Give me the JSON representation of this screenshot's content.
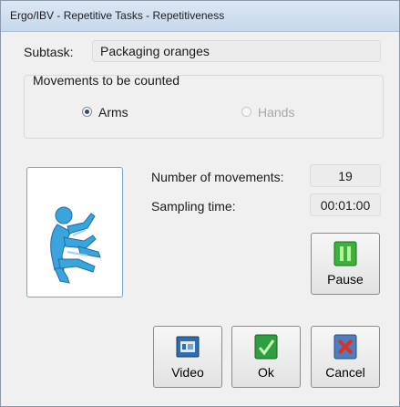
{
  "window": {
    "title": "Ergo/IBV - Repetitive Tasks - Repetitiveness"
  },
  "subtask": {
    "label": "Subtask:",
    "value": "Packaging oranges"
  },
  "movements_group": {
    "title": "Movements to be counted",
    "options": [
      {
        "label": "Arms",
        "selected": true,
        "enabled": true
      },
      {
        "label": "Hands",
        "selected": false,
        "enabled": false
      }
    ]
  },
  "figure": {
    "icon": "worker-arms-icon",
    "color": "#3aa5dd"
  },
  "stats": {
    "movements_label": "Number of movements:",
    "movements_value": "19",
    "sampling_label": "Sampling time:",
    "sampling_value": "00:01:00"
  },
  "buttons": {
    "pause": "Pause",
    "video": "Video",
    "ok": "Ok",
    "cancel": "Cancel"
  },
  "colors": {
    "pause_icon": "#3bb33b",
    "ok_icon": "#2e9e3e",
    "cancel_icon": "#d8312b",
    "video_icon": "#2d6fae"
  }
}
